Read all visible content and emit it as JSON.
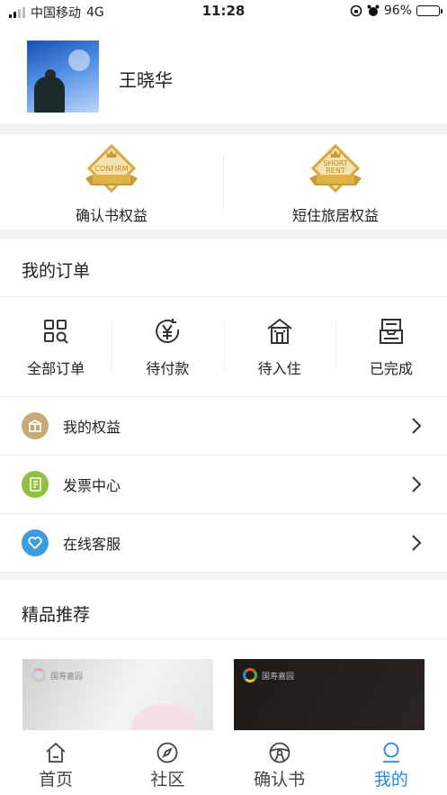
{
  "status_bar": {
    "carrier": "中国移动",
    "network": "4G",
    "time": "11:28",
    "battery": "96%",
    "battery_level": 0.96
  },
  "profile": {
    "name": "王晓华"
  },
  "benefits": [
    {
      "badge_text": "CONFIRM",
      "label": "确认书权益"
    },
    {
      "badge_text_line1": "SHORT",
      "badge_text_line2": "RENT",
      "label": "短住旅居权益"
    }
  ],
  "orders": {
    "title": "我的订单",
    "items": [
      {
        "label": "全部订单",
        "icon": "grid-search-icon"
      },
      {
        "label": "待付款",
        "icon": "yen-icon"
      },
      {
        "label": "待入住",
        "icon": "house-icon"
      },
      {
        "label": "已完成",
        "icon": "inbox-icon"
      }
    ]
  },
  "menu": {
    "items": [
      {
        "label": "我的权益",
        "icon": "benefits-icon",
        "color": "#c9a878"
      },
      {
        "label": "发票中心",
        "icon": "invoice-icon",
        "color": "#8fc13e"
      },
      {
        "label": "在线客服",
        "icon": "heart-icon",
        "color": "#3d9be0"
      }
    ]
  },
  "recommend": {
    "title": "精品推荐",
    "cards": [
      {
        "logo_text": "国寿嘉园"
      },
      {
        "logo_text": "国寿嘉园"
      }
    ]
  },
  "tabbar": {
    "accent": "#2a87dc",
    "items": [
      {
        "label": "首页",
        "icon": "home-icon"
      },
      {
        "label": "社区",
        "icon": "compass-icon"
      },
      {
        "label": "确认书",
        "icon": "steering-wheel-icon"
      },
      {
        "label": "我的",
        "icon": "profile-icon",
        "active": true
      }
    ]
  }
}
